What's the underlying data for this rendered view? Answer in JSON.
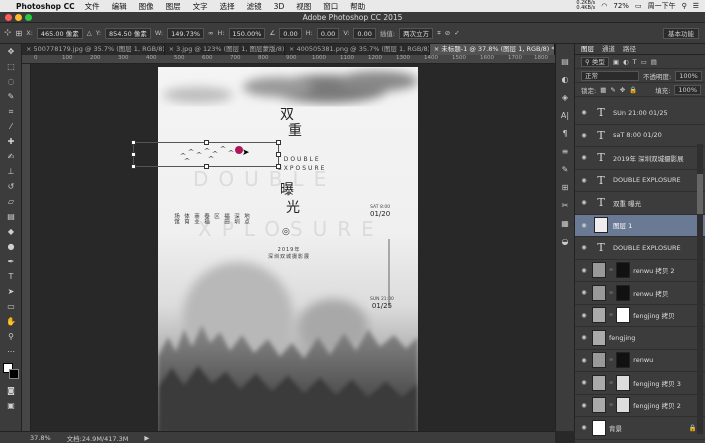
{
  "menubar": {
    "app": "Photoshop CC",
    "items": [
      "文件",
      "编辑",
      "图像",
      "图层",
      "文字",
      "选择",
      "滤镜",
      "3D",
      "视图",
      "窗口",
      "帮助"
    ],
    "net_up": "0.2KB/s",
    "net_down": "0.4KB/s",
    "battery": "72%",
    "time": "周一下午"
  },
  "window": {
    "title": "Adobe Photoshop CC 2015"
  },
  "options": {
    "x_label": "X:",
    "x": "465.00 像素",
    "y_label": "Y:",
    "y": "854.50 像素",
    "w_label": "W:",
    "w": "149.73%",
    "h_label": "H:",
    "h": "150.00%",
    "angle": "0.00",
    "hskew_label": "H:",
    "hskew": "0.00",
    "vskew_label": "V:",
    "vskew": "0.00",
    "interp_label": "插值:",
    "interp": "两次立方",
    "workspace": "基本功能"
  },
  "tabs": [
    "500778179.jpg @ 35.7% (图层 1, RGB/8)",
    "3.jpg @ 123% (图层 1, 图层蒙版/8)",
    "400505381.png @ 35.7% (图层 1, RGB/8)",
    "未标题-1 @ 37.8% (图层 1, RGB/8) *"
  ],
  "ruler": [
    "0",
    "100",
    "200",
    "300",
    "400",
    "500",
    "600",
    "700",
    "800",
    "900",
    "1000",
    "1100",
    "1200",
    "1300",
    "1400",
    "1500",
    "1600",
    "1700",
    "1800"
  ],
  "poster": {
    "title1": "双",
    "title2": "重",
    "title3": "曝",
    "title4": "光",
    "en1": "DOUBLE",
    "en2": "EXPOSURE",
    "bg1": "DOUBLE",
    "bg2": "XPLOSURE",
    "circle": "◎",
    "year": "2019年",
    "sub": "深圳双城摄影展",
    "sat_label": "SAT 8:00",
    "sat_date": "01/20",
    "sun_label": "SUN 21:00",
    "sun_date": "01/25",
    "venue_col1": "深圳",
    "venue_col2": "福田",
    "venue_col3": "地点",
    "venue_col4": "区",
    "venue_col5": "泰福",
    "venue_col6": "商业",
    "venue_col7": "体育",
    "venue_col8": "场馆"
  },
  "status": {
    "zoom": "37.8%",
    "doc": "文档:24.9M/417.3M"
  },
  "panel": {
    "tabs": [
      "图层",
      "通道",
      "路径"
    ],
    "filter": "类型",
    "blend": "正常",
    "opacity_label": "不透明度:",
    "opacity": "100%",
    "lock_label": "锁定:",
    "fill_label": "填充:",
    "fill": "100%"
  },
  "layers": [
    {
      "name": "SUn 21:00 01/25",
      "kind": "text"
    },
    {
      "name": "saT 8:00 01/20",
      "kind": "text"
    },
    {
      "name": "2019年 深圳双城摄影展",
      "kind": "text"
    },
    {
      "name": "DOUBLE EXPLOSURE",
      "kind": "text"
    },
    {
      "name": "双重 曝光",
      "kind": "text"
    },
    {
      "name": "图层 1",
      "kind": "image",
      "selected": true
    },
    {
      "name": "DOUBLE EXPLOSURE",
      "kind": "text"
    },
    {
      "name": "renwu 拷贝 2",
      "kind": "masked"
    },
    {
      "name": "renwu 拷贝",
      "kind": "masked"
    },
    {
      "name": "fengjing 拷贝",
      "kind": "masked"
    },
    {
      "name": "fengjing",
      "kind": "image"
    },
    {
      "name": "renwu",
      "kind": "masked"
    },
    {
      "name": "fengjing 拷贝 3",
      "kind": "masked"
    },
    {
      "name": "fengjing 拷贝 2",
      "kind": "masked"
    },
    {
      "name": "背景",
      "kind": "bg"
    }
  ]
}
